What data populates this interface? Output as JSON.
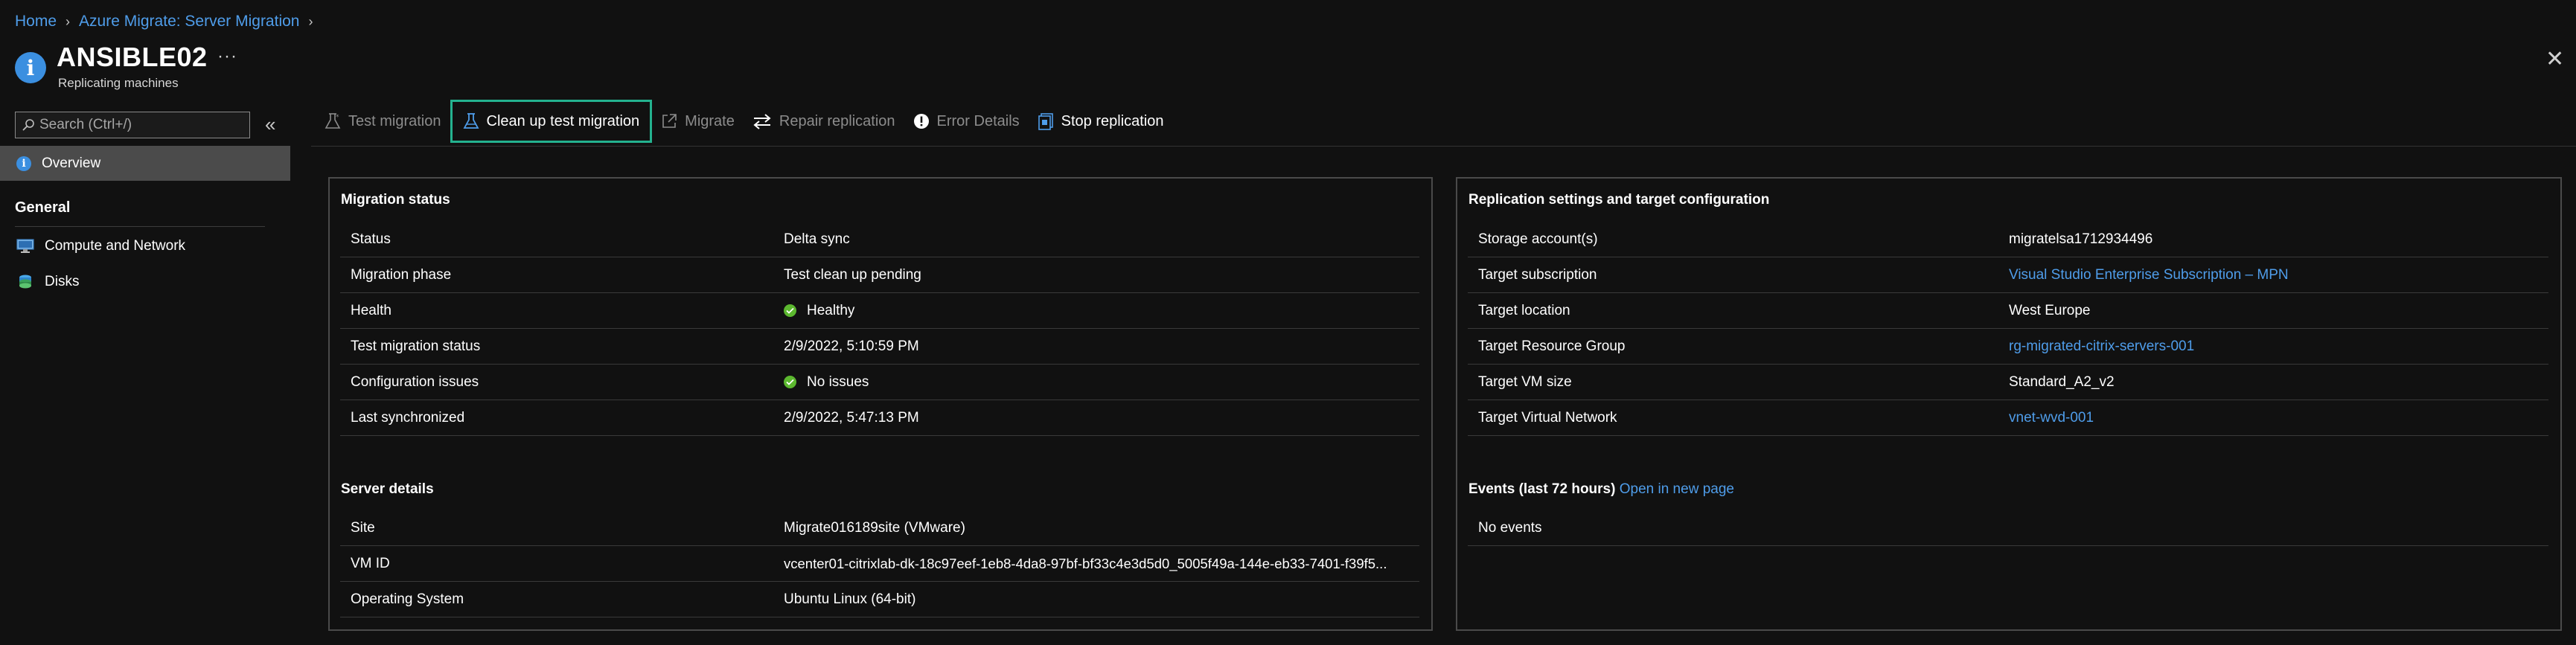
{
  "breadcrumb": [
    "Home",
    "Azure Migrate: Server Migration"
  ],
  "header": {
    "title": "ANSIBLE02",
    "subtitle": "Replicating machines",
    "more": "···",
    "close": "✕"
  },
  "sidebar": {
    "search_placeholder": "Search (Ctrl+/)",
    "collapse": "«",
    "overview": "Overview",
    "section_general": "General",
    "items": [
      {
        "label": "Compute and Network",
        "icon": "monitor-icon"
      },
      {
        "label": "Disks",
        "icon": "disks-icon"
      }
    ]
  },
  "toolbar": {
    "buttons": [
      {
        "label": "Test migration",
        "icon": "flask-icon",
        "enabled": false
      },
      {
        "label": "Clean up test migration",
        "icon": "flask-cleanup-icon",
        "enabled": true,
        "focused": true
      },
      {
        "label": "Migrate",
        "icon": "external-link-icon",
        "enabled": false
      },
      {
        "label": "Repair replication",
        "icon": "repair-arrows-icon",
        "enabled": false
      },
      {
        "label": "Error Details",
        "icon": "exclamation-icon",
        "enabled": false
      },
      {
        "label": "Stop replication",
        "icon": "stop-replication-icon",
        "enabled": true
      }
    ]
  },
  "migration_status": {
    "heading": "Migration status",
    "rows": [
      {
        "key": "Status",
        "value": "Delta sync"
      },
      {
        "key": "Migration phase",
        "value": "Test clean up pending"
      },
      {
        "key": "Health",
        "value": "Healthy",
        "icon": "check-icon"
      },
      {
        "key": "Test migration status",
        "value": "2/9/2022, 5:10:59 PM"
      },
      {
        "key": "Configuration issues",
        "value": "No issues",
        "icon": "check-icon"
      },
      {
        "key": "Last synchronized",
        "value": "2/9/2022, 5:47:13 PM"
      }
    ]
  },
  "server_details": {
    "heading": "Server details",
    "rows": [
      {
        "key": "Site",
        "value": "Migrate016189site (VMware)"
      },
      {
        "key": "VM ID",
        "value": "vcenter01-citrixlab-dk-18c97eef-1eb8-4da8-97bf-bf33c4e3d5d0_5005f49a-144e-eb33-7401-f39f5..."
      },
      {
        "key": "Operating System",
        "value": "Ubuntu Linux (64-bit)"
      }
    ]
  },
  "replication_settings": {
    "heading": "Replication settings and target configuration",
    "rows": [
      {
        "key": "Storage account(s)",
        "value": "migratelsa1712934496",
        "link": false
      },
      {
        "key": "Target subscription",
        "value": "Visual Studio Enterprise Subscription – MPN",
        "link": true
      },
      {
        "key": "Target location",
        "value": "West Europe",
        "link": false
      },
      {
        "key": "Target Resource Group",
        "value": "rg-migrated-citrix-servers-001",
        "link": true
      },
      {
        "key": "Target VM size",
        "value": "Standard_A2_v2",
        "link": false
      },
      {
        "key": "Target Virtual Network",
        "value": "vnet-wvd-001",
        "link": true
      }
    ]
  },
  "events": {
    "heading": "Events (last 72 hours)",
    "link": "Open in new page",
    "empty": "No events"
  },
  "colors": {
    "background": "#111111",
    "link": "#4f9dea",
    "focus_border": "#24b28f",
    "success": "#5cb82f",
    "info": "#3b8fe0"
  }
}
